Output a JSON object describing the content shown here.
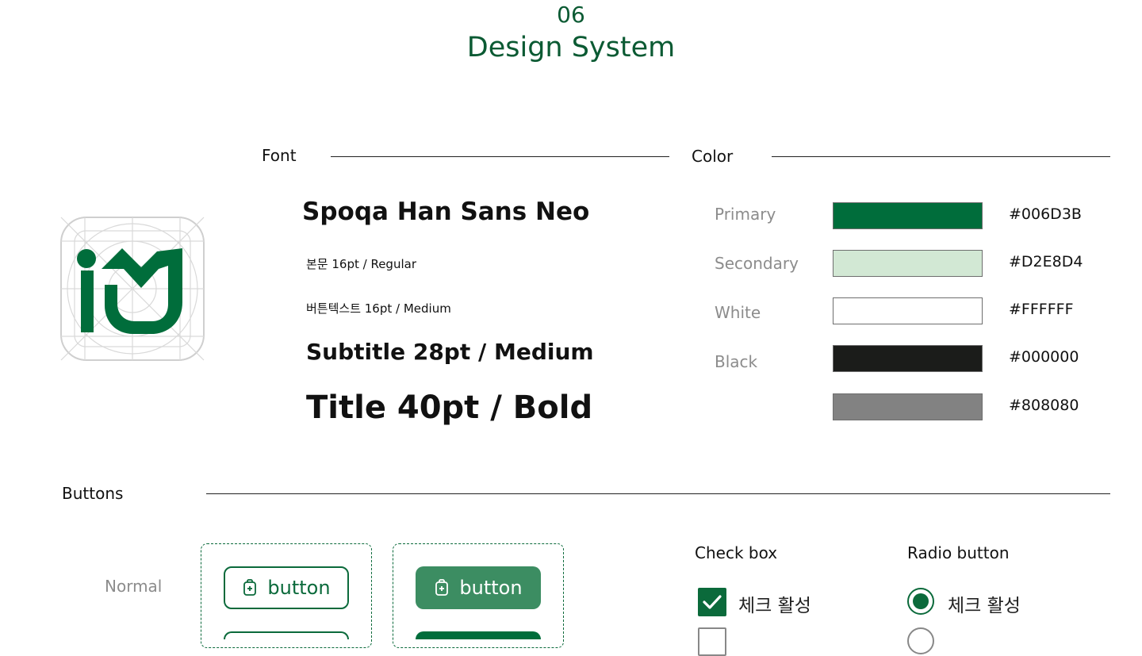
{
  "header": {
    "number": "06",
    "title": "Design System"
  },
  "font_section": {
    "heading": "Font",
    "samples": [
      "Spoqa Han Sans Neo",
      "본문 16pt / Regular",
      "버튼텍스트 16pt / Medium",
      "Subtitle 28pt / Medium",
      "Title 40pt / Bold"
    ]
  },
  "color_section": {
    "heading": "Color",
    "colors": [
      {
        "label": "Primary",
        "hex": "#006D3B"
      },
      {
        "label": "Secondary",
        "hex": "#D2E8D4"
      },
      {
        "label": "White",
        "hex": "#FFFFFF"
      },
      {
        "label": "Black",
        "hex": "#000000"
      },
      {
        "label": "",
        "hex": "#808080"
      }
    ],
    "swatch_fills": [
      "#006d3b",
      "#d2e8d4",
      "#ffffff",
      "#1b1c1a",
      "#828282"
    ]
  },
  "buttons_section": {
    "heading": "Buttons",
    "state_label": "Normal",
    "outline_button_label": "button",
    "filled_button_label": "button",
    "button_icon": "backpack-icon"
  },
  "checkbox_section": {
    "title": "Check box",
    "checked_label": "체크 활성"
  },
  "radio_section": {
    "title": "Radio button",
    "checked_label": "체크 활성"
  },
  "colors": {
    "brand_green": "#0b5a33",
    "primary": "#006D3B",
    "filled_button": "#3c8d62"
  }
}
